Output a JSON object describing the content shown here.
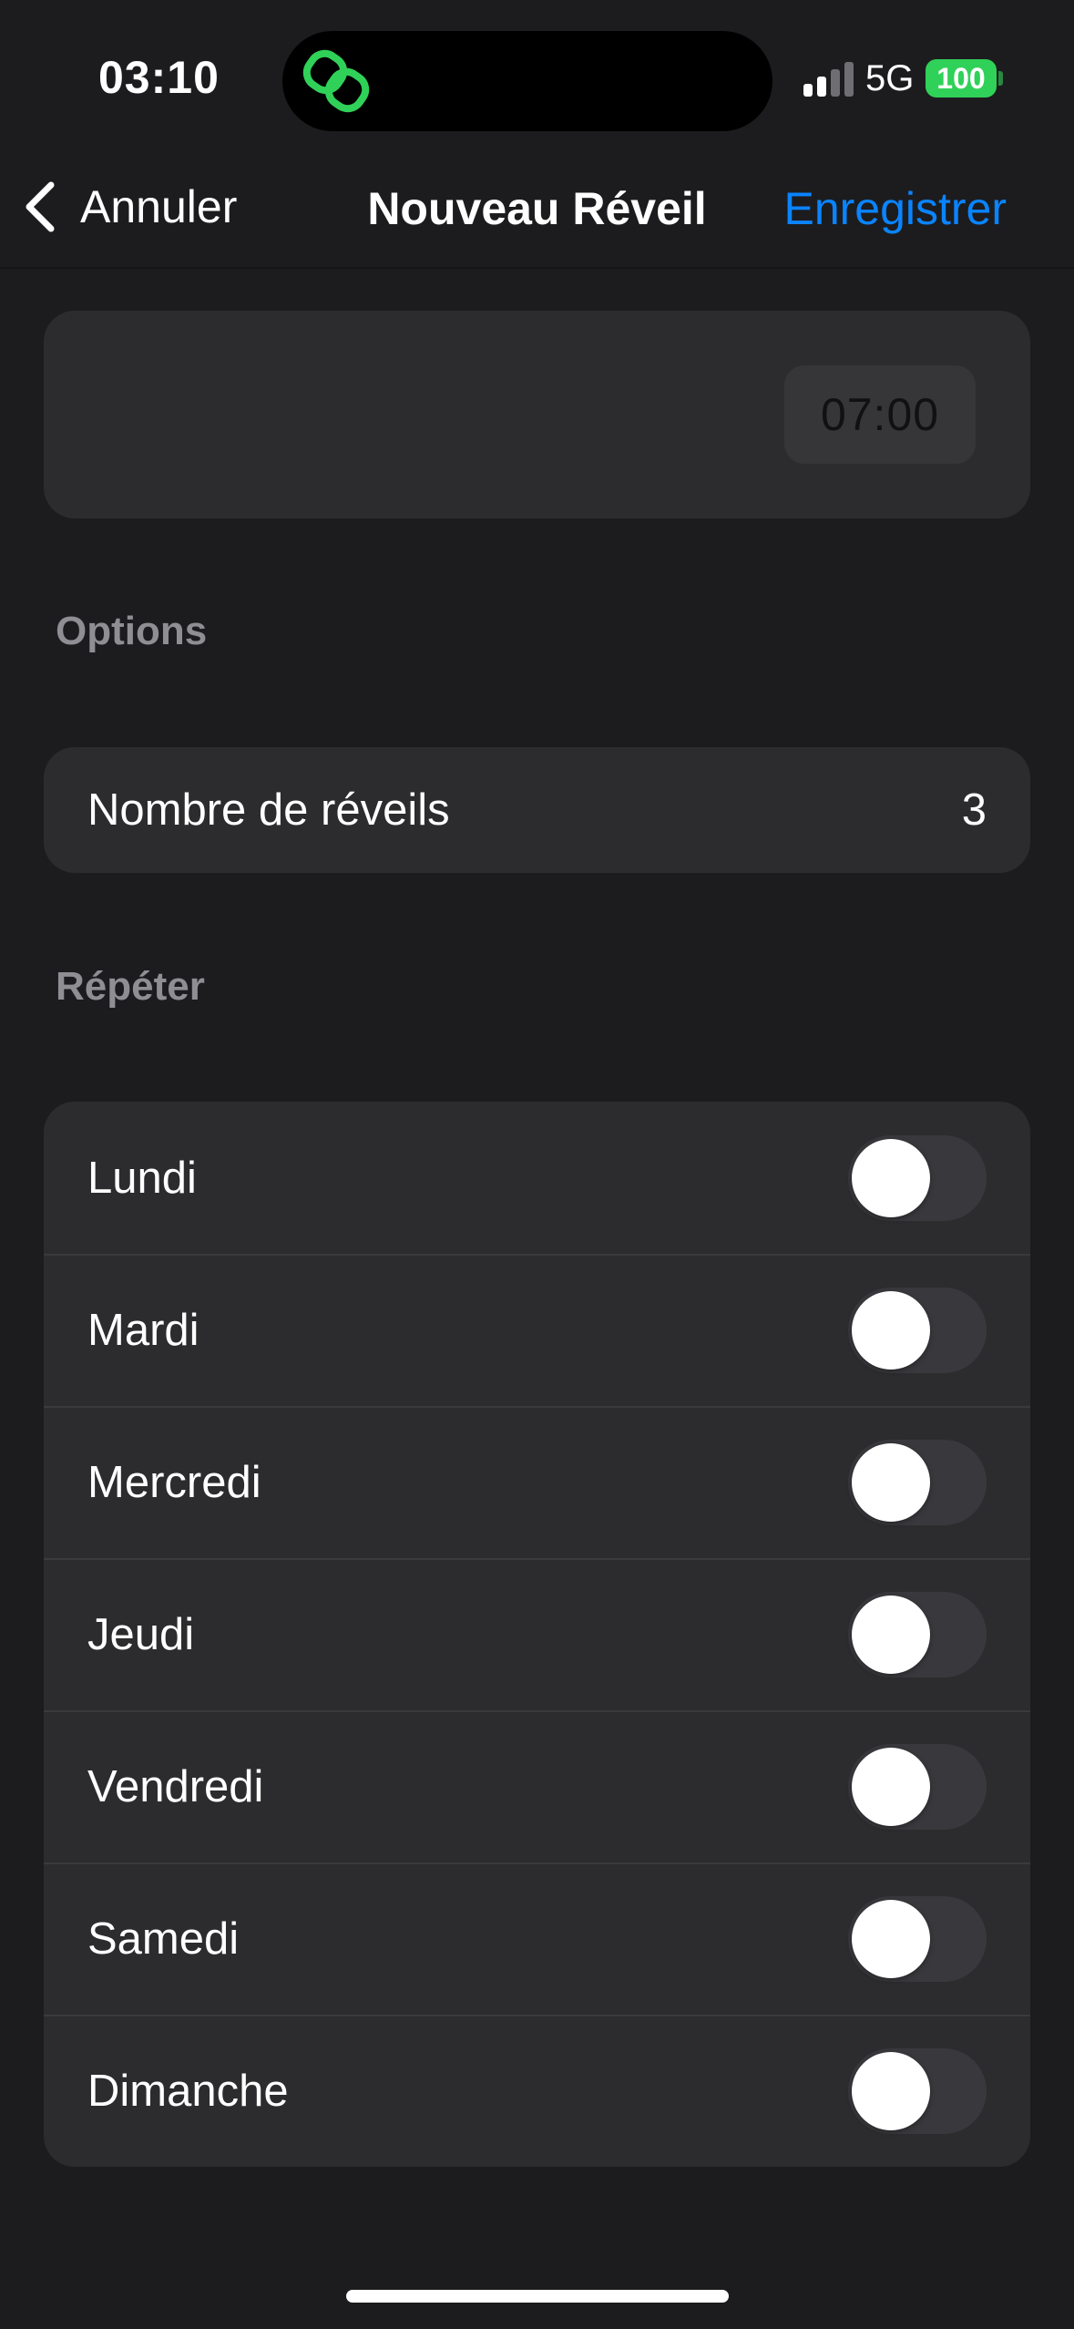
{
  "status_bar": {
    "time": "03:10",
    "network": "5G",
    "battery": "100",
    "accent": "#30d158",
    "island_icon": "link-rings-icon"
  },
  "nav": {
    "back_label": "Annuler",
    "title": "Nouveau Réveil",
    "save_label": "Enregistrer",
    "accent": "#0a84ff"
  },
  "time_picker": {
    "value": "07:00"
  },
  "options": {
    "header": "Options",
    "count_label": "Nombre de réveils",
    "count_value": "3"
  },
  "repeat": {
    "header": "Répéter",
    "days": [
      {
        "label": "Lundi",
        "on": false
      },
      {
        "label": "Mardi",
        "on": false
      },
      {
        "label": "Mercredi",
        "on": false
      },
      {
        "label": "Jeudi",
        "on": false
      },
      {
        "label": "Vendredi",
        "on": false
      },
      {
        "label": "Samedi",
        "on": false
      },
      {
        "label": "Dimanche",
        "on": false
      }
    ]
  }
}
